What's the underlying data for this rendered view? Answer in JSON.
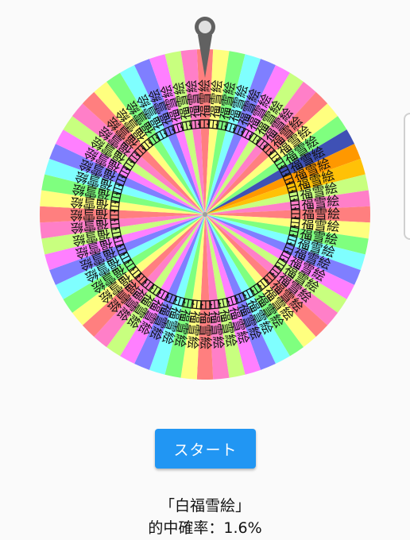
{
  "wheel": {
    "segment_count": 64,
    "colors": [
      "#ff7f7f",
      "#ffff7f",
      "#7fff7f",
      "#7fffff",
      "#7f7fff",
      "#ff7fff",
      "#c8ff7f",
      "#ff7fc8"
    ],
    "highlight_colors": [
      "#3f51b5",
      "#ff9800",
      "#ffc107"
    ],
    "label_text": "白福雪絵"
  },
  "start_button": {
    "label": "スタート"
  },
  "result": {
    "name": "「白福雪絵」",
    "probability": "的中確率：1.6%"
  }
}
